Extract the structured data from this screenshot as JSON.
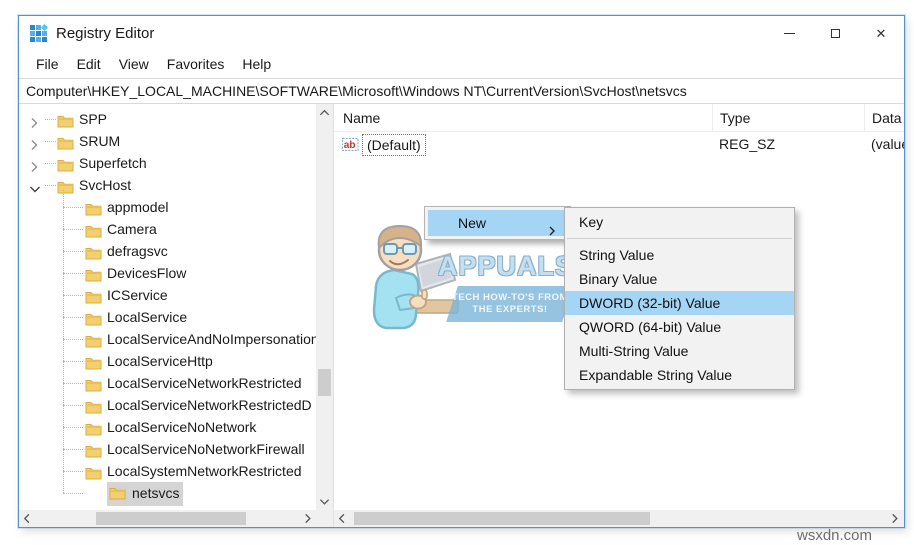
{
  "window": {
    "title": "Registry Editor",
    "controls": {
      "minimize": "minimize-icon",
      "maximize": "maximize-icon",
      "close": "close-icon",
      "close_glyph": "✕"
    }
  },
  "menubar": {
    "items": [
      "File",
      "Edit",
      "View",
      "Favorites",
      "Help"
    ]
  },
  "addressbar": {
    "path": "Computer\\HKEY_LOCAL_MACHINE\\SOFTWARE\\Microsoft\\Windows NT\\CurrentVersion\\SvcHost\\netsvcs"
  },
  "tree": {
    "items": [
      {
        "label": "SPP",
        "level": 0,
        "expander": "collapsed"
      },
      {
        "label": "SRUM",
        "level": 0,
        "expander": "collapsed"
      },
      {
        "label": "Superfetch",
        "level": 0,
        "expander": "collapsed"
      },
      {
        "label": "SvcHost",
        "level": 0,
        "expander": "expanded"
      },
      {
        "label": "appmodel",
        "level": 1,
        "expander": "none"
      },
      {
        "label": "Camera",
        "level": 1,
        "expander": "none"
      },
      {
        "label": "defragsvc",
        "level": 1,
        "expander": "none"
      },
      {
        "label": "DevicesFlow",
        "level": 1,
        "expander": "none"
      },
      {
        "label": "ICService",
        "level": 1,
        "expander": "none"
      },
      {
        "label": "LocalService",
        "level": 1,
        "expander": "none"
      },
      {
        "label": "LocalServiceAndNoImpersonation",
        "level": 1,
        "expander": "none"
      },
      {
        "label": "LocalServiceHttp",
        "level": 1,
        "expander": "none"
      },
      {
        "label": "LocalServiceNetworkRestricted",
        "level": 1,
        "expander": "none"
      },
      {
        "label": "LocalServiceNetworkRestrictedD",
        "level": 1,
        "expander": "none"
      },
      {
        "label": "LocalServiceNoNetwork",
        "level": 1,
        "expander": "none"
      },
      {
        "label": "LocalServiceNoNetworkFirewall",
        "level": 1,
        "expander": "none"
      },
      {
        "label": "LocalSystemNetworkRestricted",
        "level": 1,
        "expander": "none"
      },
      {
        "label": "netsvcs",
        "level": 1,
        "expander": "none",
        "selected": true
      },
      {
        "label": "",
        "level": 1,
        "expander": "none",
        "partial": true
      }
    ]
  },
  "list": {
    "columns": [
      "Name",
      "Type",
      "Data"
    ],
    "rows": [
      {
        "icon": "string-value-icon",
        "name": "(Default)",
        "type": "REG_SZ",
        "data": "(value not set)"
      }
    ]
  },
  "context_menu": {
    "items": [
      {
        "label": "New",
        "has_submenu": true,
        "highlighted": true
      }
    ]
  },
  "submenu": {
    "items": [
      {
        "label": "Key"
      },
      {
        "separator": true
      },
      {
        "label": "String Value"
      },
      {
        "label": "Binary Value"
      },
      {
        "label": "DWORD (32-bit) Value",
        "highlighted": true
      },
      {
        "label": "QWORD (64-bit) Value"
      },
      {
        "label": "Multi-String Value"
      },
      {
        "label": "Expandable String Value"
      }
    ]
  },
  "watermark": {
    "brand": "APPUALS",
    "tagline_line1": "TECH HOW-TO'S FROM",
    "tagline_line2": "THE EXPERTS!"
  },
  "footer": {
    "site": "wsxdn.com"
  },
  "colors": {
    "window_border": "#4f94cd",
    "menu_highlight": "#a5d5f5",
    "selection_inactive": "#d4d4d4",
    "folder": "#f3cf70",
    "scrollbar_track": "#f0f0f0",
    "scrollbar_thumb": "#cdcdcd"
  }
}
